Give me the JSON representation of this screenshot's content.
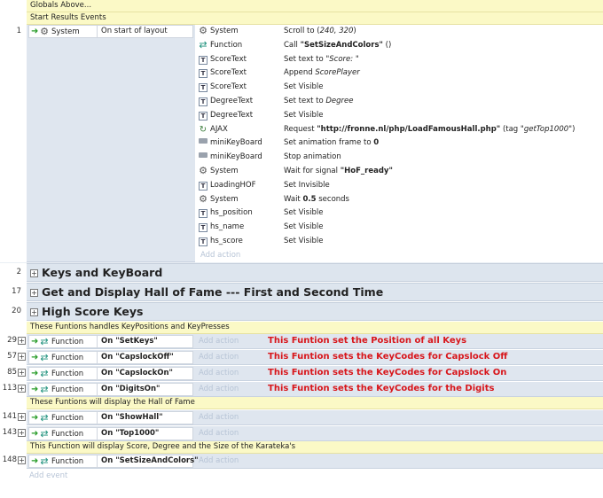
{
  "top": {
    "globals": "Globals Above...",
    "start_comment": "Start Results Events"
  },
  "event1": {
    "num": "1",
    "cond_obj": "System",
    "cond_txt": "On start of layout",
    "actions": [
      {
        "obj": "System",
        "icon": "gear-icon",
        "parts": [
          "Scroll to (",
          {
            "i": "240, 320"
          },
          ")"
        ]
      },
      {
        "obj": "Function",
        "icon": "function-icon",
        "parts": [
          "Call ",
          {
            "b": "\"SetSizeAndColors\""
          },
          " ()"
        ]
      },
      {
        "obj": "ScoreText",
        "icon": "text-icon",
        "parts": [
          "Set text to ",
          {
            "i": "\"Score: \""
          }
        ]
      },
      {
        "obj": "ScoreText",
        "icon": "text-icon",
        "parts": [
          "Append ",
          {
            "i": "ScorePlayer"
          }
        ]
      },
      {
        "obj": "ScoreText",
        "icon": "text-icon",
        "parts": [
          "Set Visible"
        ]
      },
      {
        "obj": "DegreeText",
        "icon": "text-icon",
        "parts": [
          "Set text to ",
          {
            "i": "Degree"
          }
        ]
      },
      {
        "obj": "DegreeText",
        "icon": "text-icon",
        "parts": [
          "Set Visible"
        ]
      },
      {
        "obj": "AJAX",
        "icon": "ajax-icon",
        "parts": [
          "Request ",
          {
            "b": "\"http://fronne.nl/php/LoadFamousHall.php\""
          },
          " (tag ",
          {
            "i": "\"getTop1000\""
          },
          ")"
        ]
      },
      {
        "obj": "miniKeyBoard",
        "icon": "keyboard-icon",
        "parts": [
          "Set animation frame to ",
          {
            "b": "0"
          }
        ]
      },
      {
        "obj": "miniKeyBoard",
        "icon": "keyboard-icon",
        "parts": [
          "Stop animation"
        ]
      },
      {
        "obj": "System",
        "icon": "gear-icon",
        "parts": [
          "Wait for signal ",
          {
            "b": "\"HoF_ready\""
          }
        ]
      },
      {
        "obj": "LoadingHOF",
        "icon": "text-icon",
        "parts": [
          "Set Invisible"
        ]
      },
      {
        "obj": "System",
        "icon": "gear-icon",
        "parts": [
          "Wait ",
          {
            "b": "0.5"
          },
          " seconds"
        ]
      },
      {
        "obj": "hs_position",
        "icon": "text-icon",
        "parts": [
          "Set Visible"
        ]
      },
      {
        "obj": "hs_name",
        "icon": "text-icon",
        "parts": [
          "Set Visible"
        ]
      },
      {
        "obj": "hs_score",
        "icon": "text-icon",
        "parts": [
          "Set Visible"
        ]
      }
    ],
    "add_action": "Add action"
  },
  "groups": [
    {
      "num": "2",
      "title": "Keys and KeyBoard"
    },
    {
      "num": "17",
      "title": "Get and Display Hall of Fame --- First and Second Time"
    },
    {
      "num": "20",
      "title": "High Score Keys"
    }
  ],
  "comment_keys": "These Funtions handles KeyPositions and KeyPresses",
  "key_events": [
    {
      "num": "29",
      "obj": "Function",
      "cond": "On \"SetKeys\"",
      "note": "This Funtion set the Position of all Keys"
    },
    {
      "num": "57",
      "obj": "Function",
      "cond": "On \"CapslockOff\"",
      "note": "This Funtion sets the KeyCodes for Capslock Off"
    },
    {
      "num": "85",
      "obj": "Function",
      "cond": "On \"CapslockOn\"",
      "note": "This Funtion sets the KeyCodes for Capslock On"
    },
    {
      "num": "113",
      "obj": "Function",
      "cond": "On \"DigitsOn\"",
      "note": "This Funtion sets the KeyCodes for the Digits"
    }
  ],
  "comment_hall": "These Funtions will display the Hall of Fame",
  "hall_events": [
    {
      "num": "141",
      "obj": "Function",
      "cond": "On \"ShowHall\""
    },
    {
      "num": "143",
      "obj": "Function",
      "cond": "On \"Top1000\""
    }
  ],
  "comment_size": "This Function will display Score, Degree and the Size of the Karateka's",
  "size_event": {
    "num": "148",
    "obj": "Function",
    "cond": "On \"SetSizeAndColors\""
  },
  "add_event": "Add event",
  "add_action": "Add action",
  "colors": {
    "note_red": "#d8161b",
    "comment_bg": "#fbf9c6",
    "event_bg": "#dfe6ef"
  }
}
